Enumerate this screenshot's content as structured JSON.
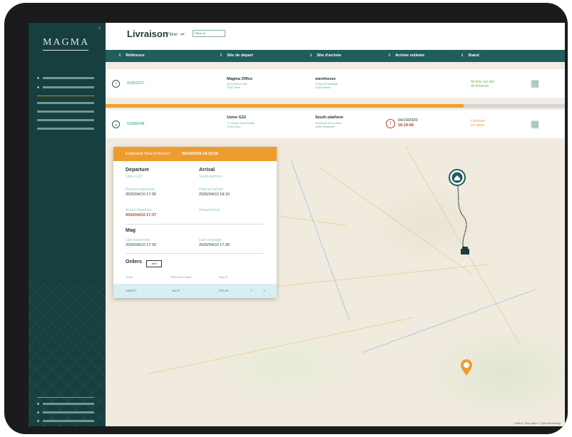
{
  "brand": {
    "logo": "MAGMA"
  },
  "header": {
    "title": "Livraison",
    "filter_label": "Filtrer",
    "filter_icon": "sliders-icon",
    "filter_value": "Filtrer ici"
  },
  "table": {
    "columns": [
      "Référence",
      "Site de départ",
      "Site d'arrivée",
      "Arrivée estimée",
      "Statut"
    ],
    "rows": [
      {
        "reference": "01802217",
        "departure_name": "Magma Office",
        "departure_addr1": "46 rue Raoul Clair",
        "departure_addr2": "75010 Paris",
        "arrival_name": "warehouse",
        "arrival_addr1": "16 Rue de la Bastille",
        "arrival_addr2": "44000 Nantes",
        "eta_date": "",
        "eta_time": "",
        "status_line1": "Arrivée sur site",
        "status_line2": "de livraison",
        "status_color": "#7ab648"
      },
      {
        "reference": "01806548",
        "departure_name": "Usine G22",
        "departure_addr1": "77, avenue Jean Portalis",
        "departure_addr2": "37000 Tours",
        "arrival_name": "South platform",
        "arrival_addr1": "26 Avenue de la Liberté",
        "arrival_addr2": "34000 Montpellier",
        "eta_date": "04/10/2020",
        "eta_time": "18:19:06",
        "status_line1": "Livraison",
        "status_line2": "en cours",
        "status_color": "#ef9c2e"
      }
    ]
  },
  "progress": {
    "fraction": 0.78,
    "color": "#f0a032"
  },
  "popup": {
    "eta_label": "Estimated Time of Arrival :",
    "eta_value": "04/10/2020 18:19:06",
    "departure_label": "Departure",
    "departure_site": "Usine G22",
    "arrival_label": "Arrival",
    "arrival_site": "South platform",
    "planned_departure_label": "Planned departure",
    "planned_departure": "2020/04/10 17:30",
    "planned_arrival_label": "Planned arrival",
    "planned_arrival": "2020/04/10 18:10",
    "actual_departure_label": "Actual departure",
    "actual_departure": "2020/04/10 17:37",
    "actual_arrival_label": "Actual arrival",
    "mag_label": "Mag",
    "last_movement_label": "Last movement",
    "last_movement": "2020/04/10 17:30",
    "last_message_label": "Last message",
    "last_message": "2020/04/10 17:30",
    "orders_label": "Orders",
    "add_label": "Add",
    "orders_columns": [
      "Order",
      "Référence Asset",
      "Mag ID"
    ],
    "order_row": {
      "order": "01802217",
      "asset": "Ass 03",
      "mag": "P301.06"
    }
  },
  "map": {
    "attribution": "Leaflet | Map data © OpenStreetMap"
  },
  "colors": {
    "sidebar": "#173f3f",
    "table_header": "#1f5e5c",
    "accent_orange": "#ef9c2e",
    "accent_teal": "#2f9a8f",
    "alert_red": "#c0392b"
  }
}
